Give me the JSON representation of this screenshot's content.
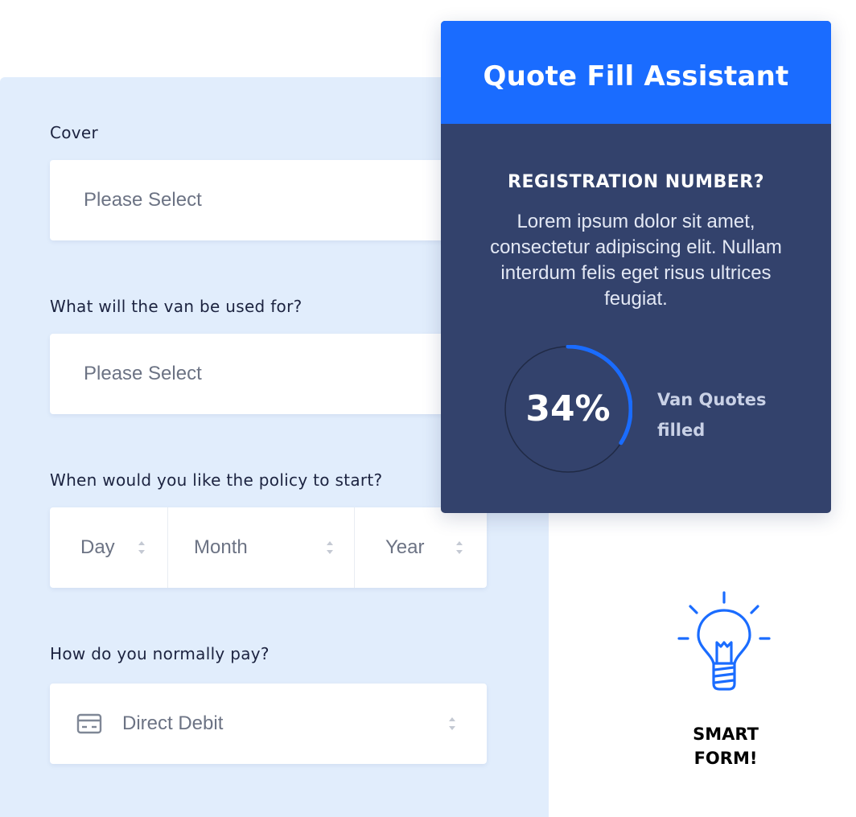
{
  "form": {
    "cover_label": "Cover",
    "cover_value": "Please Select",
    "usage_label": "What will the van be used for?",
    "usage_value": "Please Select",
    "start_label": "When would you like the policy to start?",
    "start_day": "Day",
    "start_month": "Month",
    "start_year": "Year",
    "pay_label": "How do you normally pay?",
    "pay_value": "Direct Debit"
  },
  "assistant": {
    "title": "Quote Fill Assistant",
    "question": "REGISTRATION NUMBER?",
    "description": "Lorem ipsum dolor sit amet, consectetur adipiscing elit. Nullam interdum felis eget risus ultrices feugiat.",
    "progress_percent": 34,
    "progress_text": "34%",
    "progress_label": "Van Quotes filled"
  },
  "promo": {
    "smart_label": "SMART FORM!"
  },
  "colors": {
    "accent": "#1a6cff",
    "panel": "#33426c",
    "form_bg": "#e1edfc"
  },
  "icons": {
    "payment": "credit-card-icon",
    "select": "updown-arrows-icon",
    "promo": "lightbulb-icon"
  }
}
